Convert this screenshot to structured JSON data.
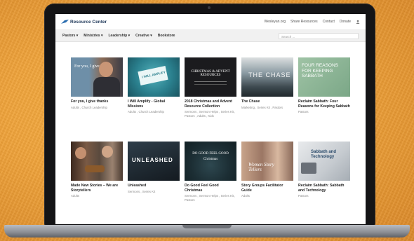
{
  "header": {
    "logo_text": "Resource Center",
    "links": [
      "Wesleyan.org",
      "Share Resources",
      "Contact",
      "Donate"
    ]
  },
  "nav": {
    "items": [
      "Pastors",
      "Ministries",
      "Leadership",
      "Creative",
      "Bookstore"
    ],
    "search_placeholder": "Search ..."
  },
  "cards": [
    {
      "title": "For you, I give thanks",
      "tags": "Adults , Church Leadership",
      "thumb_text": "For you, I give thanks"
    },
    {
      "title": "I Will Amplify - Global Missions",
      "tags": "Adults , Church Leadership",
      "thumb_text": "I WILL AMPLIFY"
    },
    {
      "title": "2018 Christmas and Advent Resource Collection",
      "tags": "Sermons , Sermon Helps , Series Kit , Pastors , Adults , Kids",
      "thumb_text": "CHRISTMAS & ADVENT RESOURCES"
    },
    {
      "title": "The Chase",
      "tags": "Marketing , Series Kit , Pastors",
      "thumb_text": "THE CHASE"
    },
    {
      "title": "Reclaim Sabbath: Four Reasons for Keeping Sabbath",
      "tags": "Pastors",
      "thumb_text": "FOUR REASONS FOR KEEPING SABBATH"
    },
    {
      "title": "Made New Stories – We are Storytellers",
      "tags": "Adults",
      "thumb_text": ""
    },
    {
      "title": "Unleashed",
      "tags": "Sermons , Series Kit",
      "thumb_text": "UNLEASHED"
    },
    {
      "title": "Do Good Feel Good Christmas",
      "tags": "Sermons , Sermon Helps , Series Kit , Pastors",
      "thumb_text": "DO GOOD FEEL GOOD Christmas"
    },
    {
      "title": "Story Groups Facilitator Guide",
      "tags": "Adults",
      "thumb_text": "Women Story Tellers"
    },
    {
      "title": "Reclaim Sabbath: Sabbath and Technology",
      "tags": "Pastors",
      "thumb_text": "Sabbath and Technology"
    }
  ],
  "colors": {
    "accent_orange": "#f0a43c",
    "brand_navy": "#223b5c"
  }
}
